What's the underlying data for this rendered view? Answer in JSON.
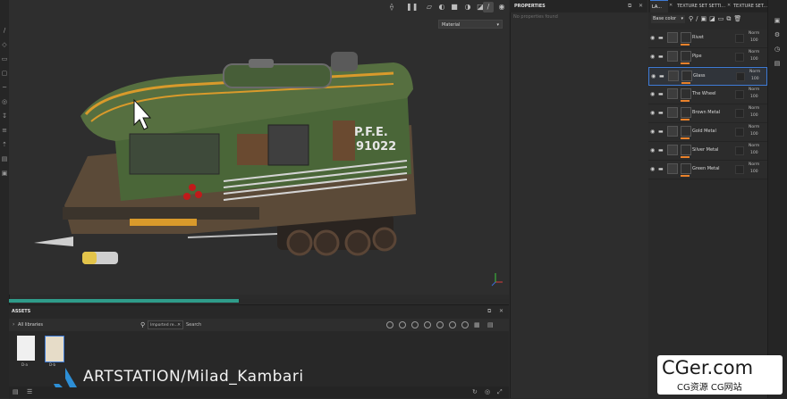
{
  "viewport": {
    "material_dropdown": "Material",
    "progress_fraction": 0.46,
    "train_labels": {
      "line1": "P.F.E.",
      "line2": "91022"
    }
  },
  "properties": {
    "title": "PROPERTIES",
    "empty_text": "No properties found"
  },
  "layers": {
    "tabs": [
      "LA...",
      "TEXTURE SET SETTI...",
      "TEXTURE SET..."
    ],
    "base_color": "Base color",
    "items": [
      {
        "name": "Rivet",
        "blend": "Norm",
        "opacity": "100"
      },
      {
        "name": "Pipe",
        "blend": "Norm",
        "opacity": "100"
      },
      {
        "name": "Glass",
        "blend": "Norm",
        "opacity": "100"
      },
      {
        "name": "The Wheel",
        "blend": "Norm",
        "opacity": "100"
      },
      {
        "name": "Brown Metal",
        "blend": "Norm",
        "opacity": "100"
      },
      {
        "name": "Gold Metal",
        "blend": "Norm",
        "opacity": "100"
      },
      {
        "name": "Silver Metal",
        "blend": "Norm",
        "opacity": "100"
      },
      {
        "name": "Green Metal",
        "blend": "Norm",
        "opacity": "100"
      }
    ]
  },
  "assets": {
    "title": "ASSETS",
    "library": "All libraries",
    "filter_chip": "Imported re...",
    "search_label": "Search",
    "thumbs": [
      "D-a",
      "D-b"
    ]
  },
  "watermark": {
    "brand": "ARTSTATION/Milad_Kambari",
    "site": "CGer.com",
    "site_sub": "CG资源 CG网站"
  },
  "colors": {
    "accent": "#3e7bd6",
    "progress": "#2f9c8a",
    "orange": "#e8812b",
    "train_green": "#4f6b3c",
    "train_yellow": "#d99a2b"
  }
}
